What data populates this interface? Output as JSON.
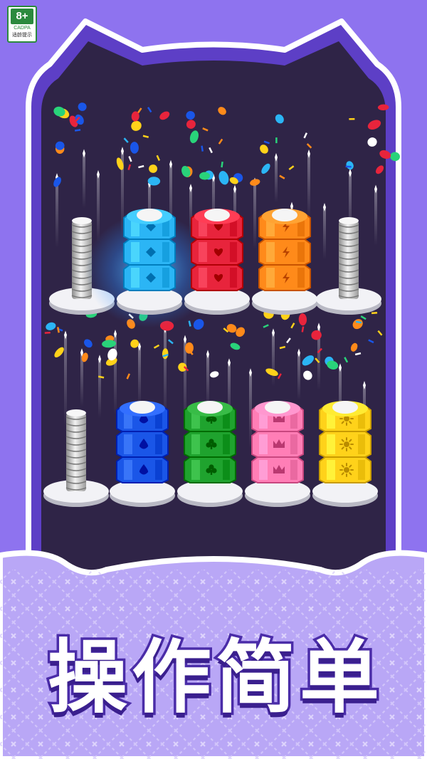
{
  "age_rating": {
    "age": "8+",
    "org": "CADPA",
    "note": "适龄提示"
  },
  "caption": {
    "chars": [
      "操",
      "作",
      "简",
      "单"
    ]
  },
  "colors": {
    "background": "#8e73ef",
    "board": "#2f2447",
    "frame": "#5d3fc6",
    "bottom_band": "#b9a7f6",
    "caption_text": "#ffffff",
    "caption_stroke": "#4a2ca8"
  },
  "game": {
    "top_row": [
      {
        "color": "#9e9e9e",
        "icon": "none",
        "stack": 0,
        "state": "empty-bolt"
      },
      {
        "color": "#2bb5f5",
        "icon": "diamond-icon",
        "stack": 3,
        "state": "complete",
        "glow": true
      },
      {
        "color": "#e8243c",
        "icon": "heart-icon",
        "stack": 3,
        "state": "complete"
      },
      {
        "color": "#ff8a1a",
        "icon": "lightning-icon",
        "stack": 3,
        "state": "complete"
      },
      {
        "color": "#9e9e9e",
        "icon": "none",
        "stack": 0,
        "state": "empty-bolt"
      }
    ],
    "bottom_row": [
      {
        "color": "#9e9e9e",
        "icon": "none",
        "stack": 0,
        "state": "empty-bolt"
      },
      {
        "color": "#1a56e8",
        "icon": "drop-icon",
        "stack": 3,
        "state": "complete"
      },
      {
        "color": "#1fa32e",
        "icon": "club-icon",
        "stack": 3,
        "state": "complete"
      },
      {
        "color": "#ff7eb6",
        "icon": "crown-icon",
        "stack": 3,
        "state": "complete"
      },
      {
        "color": "#ffd21a",
        "icon": "sun-icon",
        "stack": 3,
        "state": "complete"
      }
    ],
    "confetti_colors": [
      "#ffd21a",
      "#ff8a1a",
      "#e8243c",
      "#1a56e8",
      "#2bb5f5",
      "#29d37a",
      "#ffffff"
    ]
  }
}
